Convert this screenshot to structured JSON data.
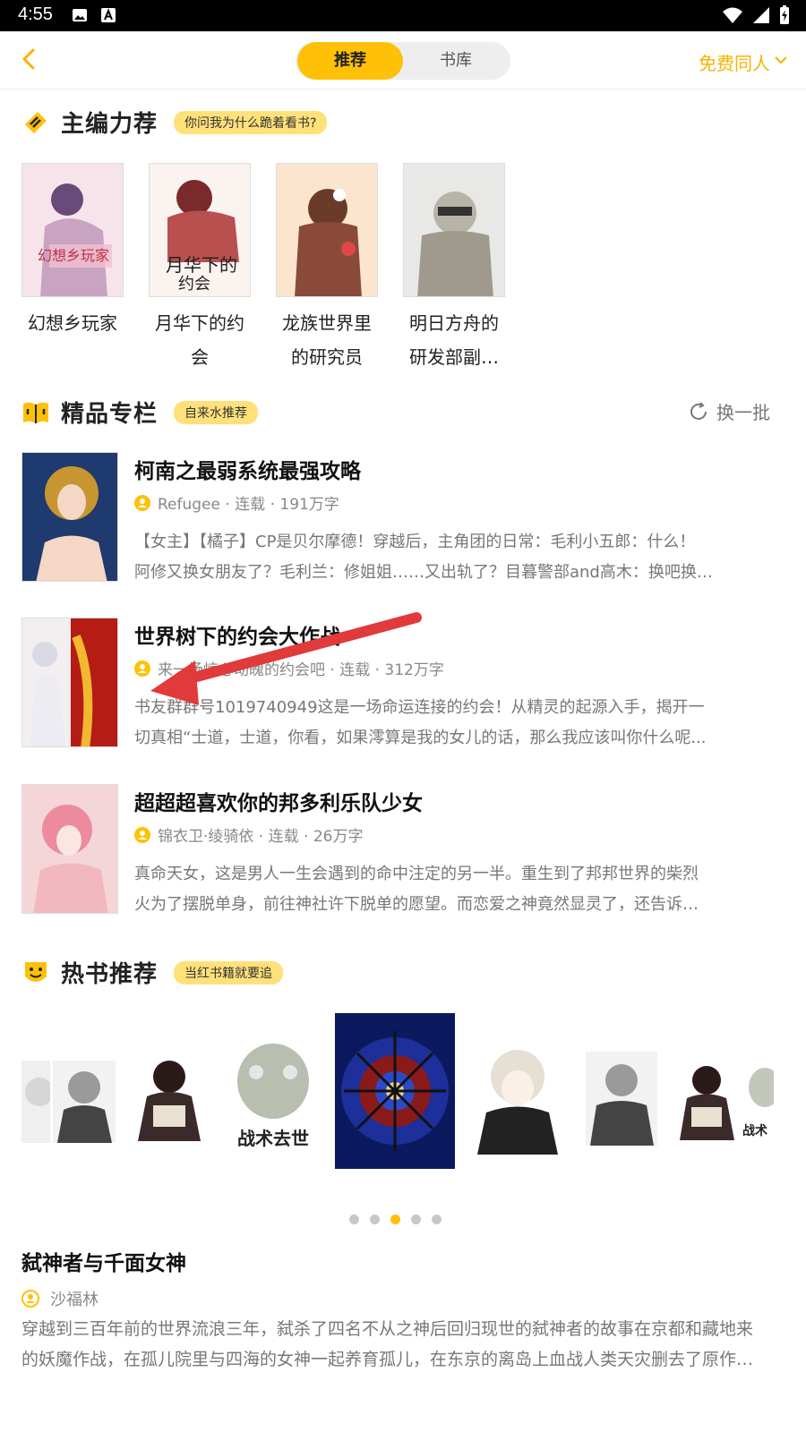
{
  "status_bar": {
    "time": "4:55"
  },
  "header": {
    "back_icon": "chevron-left-icon",
    "tabs": [
      {
        "label": "推荐",
        "active": true
      },
      {
        "label": "书库",
        "active": false
      }
    ],
    "filter_label": "免费同人",
    "accent_color": "#ffc107"
  },
  "editor_picks": {
    "title": "主编力荐",
    "tag": "你问我为什么跪着看书?",
    "books": [
      {
        "title_line1": "幻想乡玩家",
        "title_line2": ""
      },
      {
        "title_line1": "月华下的约",
        "title_line2": "会"
      },
      {
        "title_line1": "龙族世界里",
        "title_line2": "的研究员"
      },
      {
        "title_line1": "明日方舟的",
        "title_line2": "研发部副…"
      }
    ]
  },
  "premium": {
    "title": "精品专栏",
    "tag": "自来水推荐",
    "refresh_label": "换一批",
    "books": [
      {
        "title": "柯南之最弱系统最强攻略",
        "meta": "Refugee · 连载 · 191万字",
        "desc_line1": "【女主】【橘子】CP是贝尔摩德！穿越后，主角团的日常：毛利小五郎：什么！",
        "desc_line2": "阿修又换女朋友了？毛利兰：修姐姐……又出轨了？目暮警部and高木：换吧换…"
      },
      {
        "title": "世界树下的约会大作战",
        "meta": "来一场惊心动魄的约会吧 · 连载 · 312万字",
        "desc_line1": "书友群群号1019740949这是一场命运连接的约会！从精灵的起源入手，揭开一",
        "desc_line2": "切真相“士道，士道，你看，如果澪算是我的女儿的话，那么我应该叫你什么呢..."
      },
      {
        "title": "超超超喜欢你的邦多利乐队少女",
        "meta": "锦衣卫·绫骑依 · 连载 · 26万字",
        "desc_line1": "真命天女，这是男人一生会遇到的命中注定的另一半。重生到了邦邦世界的柴烈",
        "desc_line2": "火为了摆脱单身，前往神社许下脱单的愿望。而恋爱之神竟然显灵了，还告诉…"
      }
    ]
  },
  "hot_books": {
    "title": "热书推荐",
    "tag": "当红书籍就要追",
    "cover_captions": {
      "tactics": "战术去世",
      "tactics_partial": "战术"
    },
    "active_dot": 2,
    "dot_count": 5,
    "featured": {
      "title": "弑神者与千面女神",
      "author": "沙福林",
      "desc_line1": "穿越到三百年前的世界流浪三年，弑杀了四名不从之神后回归现世的弑神者的故事在京都和藏地来",
      "desc_line2": "的妖魔作战，在孤儿院里与四海的女神一起养育孤儿，在东京的离岛上血战人类天灾删去了原作…"
    }
  }
}
